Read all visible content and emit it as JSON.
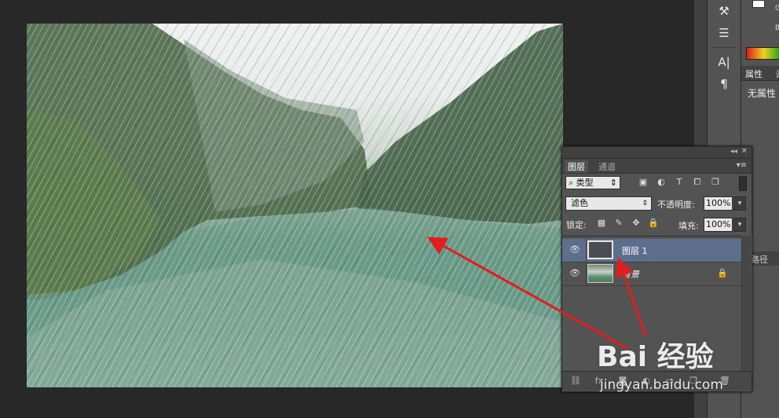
{
  "layers_panel": {
    "tabs": [
      "图层",
      "通道"
    ],
    "filter_label": "类型",
    "blend_mode": "滤色",
    "opacity_label": "不透明度:",
    "opacity_value": "100%",
    "lock_label": "锁定:",
    "fill_label": "填充:",
    "fill_value": "100%",
    "layers": [
      {
        "name": "图层 1",
        "selected": true,
        "locked": false
      },
      {
        "name": "背景",
        "selected": false,
        "locked": true
      }
    ]
  },
  "properties_panel": {
    "tab_label": "属性",
    "tab2_label": "调",
    "no_properties": "无属性",
    "color_g": "G",
    "color_b": "B",
    "lower_tab": "路径"
  },
  "watermark": {
    "top": "Bai 经验",
    "bottom": "jingyan.baidu.com"
  },
  "colors": {
    "arrow": "#e31d1d",
    "selected_layer": "#5d6f8c",
    "panel_bg": "#535353"
  }
}
